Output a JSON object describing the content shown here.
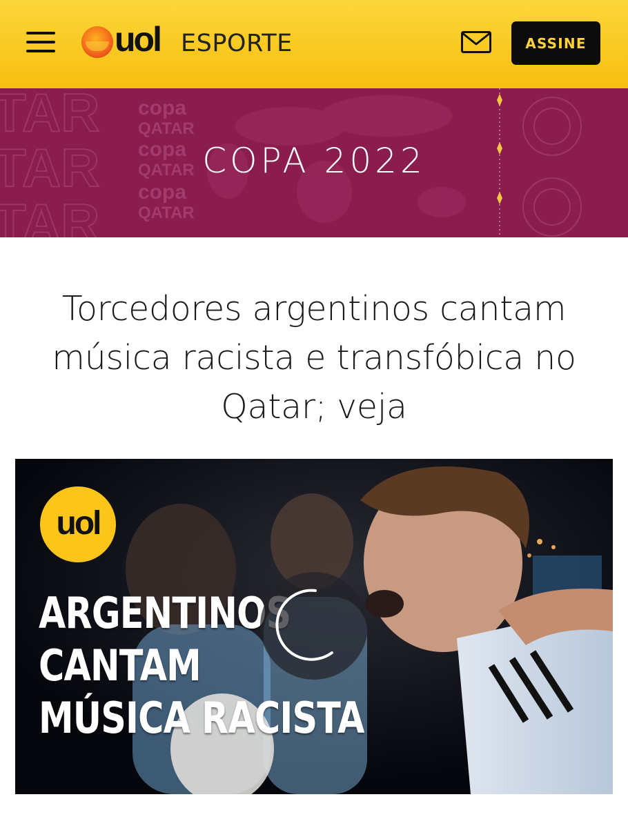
{
  "header": {
    "logo_text": "uol",
    "section": "ESPORTE",
    "subscribe_label": "ASSINE",
    "menu_icon": "hamburger-menu-icon",
    "mail_icon": "mail-icon",
    "colors": {
      "background": "#f9c922",
      "button_bg": "#0c0c0c",
      "button_text": "#fcd23a"
    }
  },
  "banner": {
    "title": "COPA 2022",
    "bg_text_copa": "copa",
    "bg_text_qatar": "QATAR",
    "bg_text_tar": "TAR",
    "colors": {
      "background": "#8a1d4e",
      "accent": "#f5c543"
    }
  },
  "article": {
    "headline": "Torcedores argentinos cantam música racista e transfóbica no Qatar; veja"
  },
  "video": {
    "badge_text": "uol",
    "caption_lines": [
      "ARGENTINOS",
      "CANTAM",
      "MÚSICA RACISTA"
    ],
    "state": "loading",
    "spinner_icon": "loading-spinner-icon"
  }
}
